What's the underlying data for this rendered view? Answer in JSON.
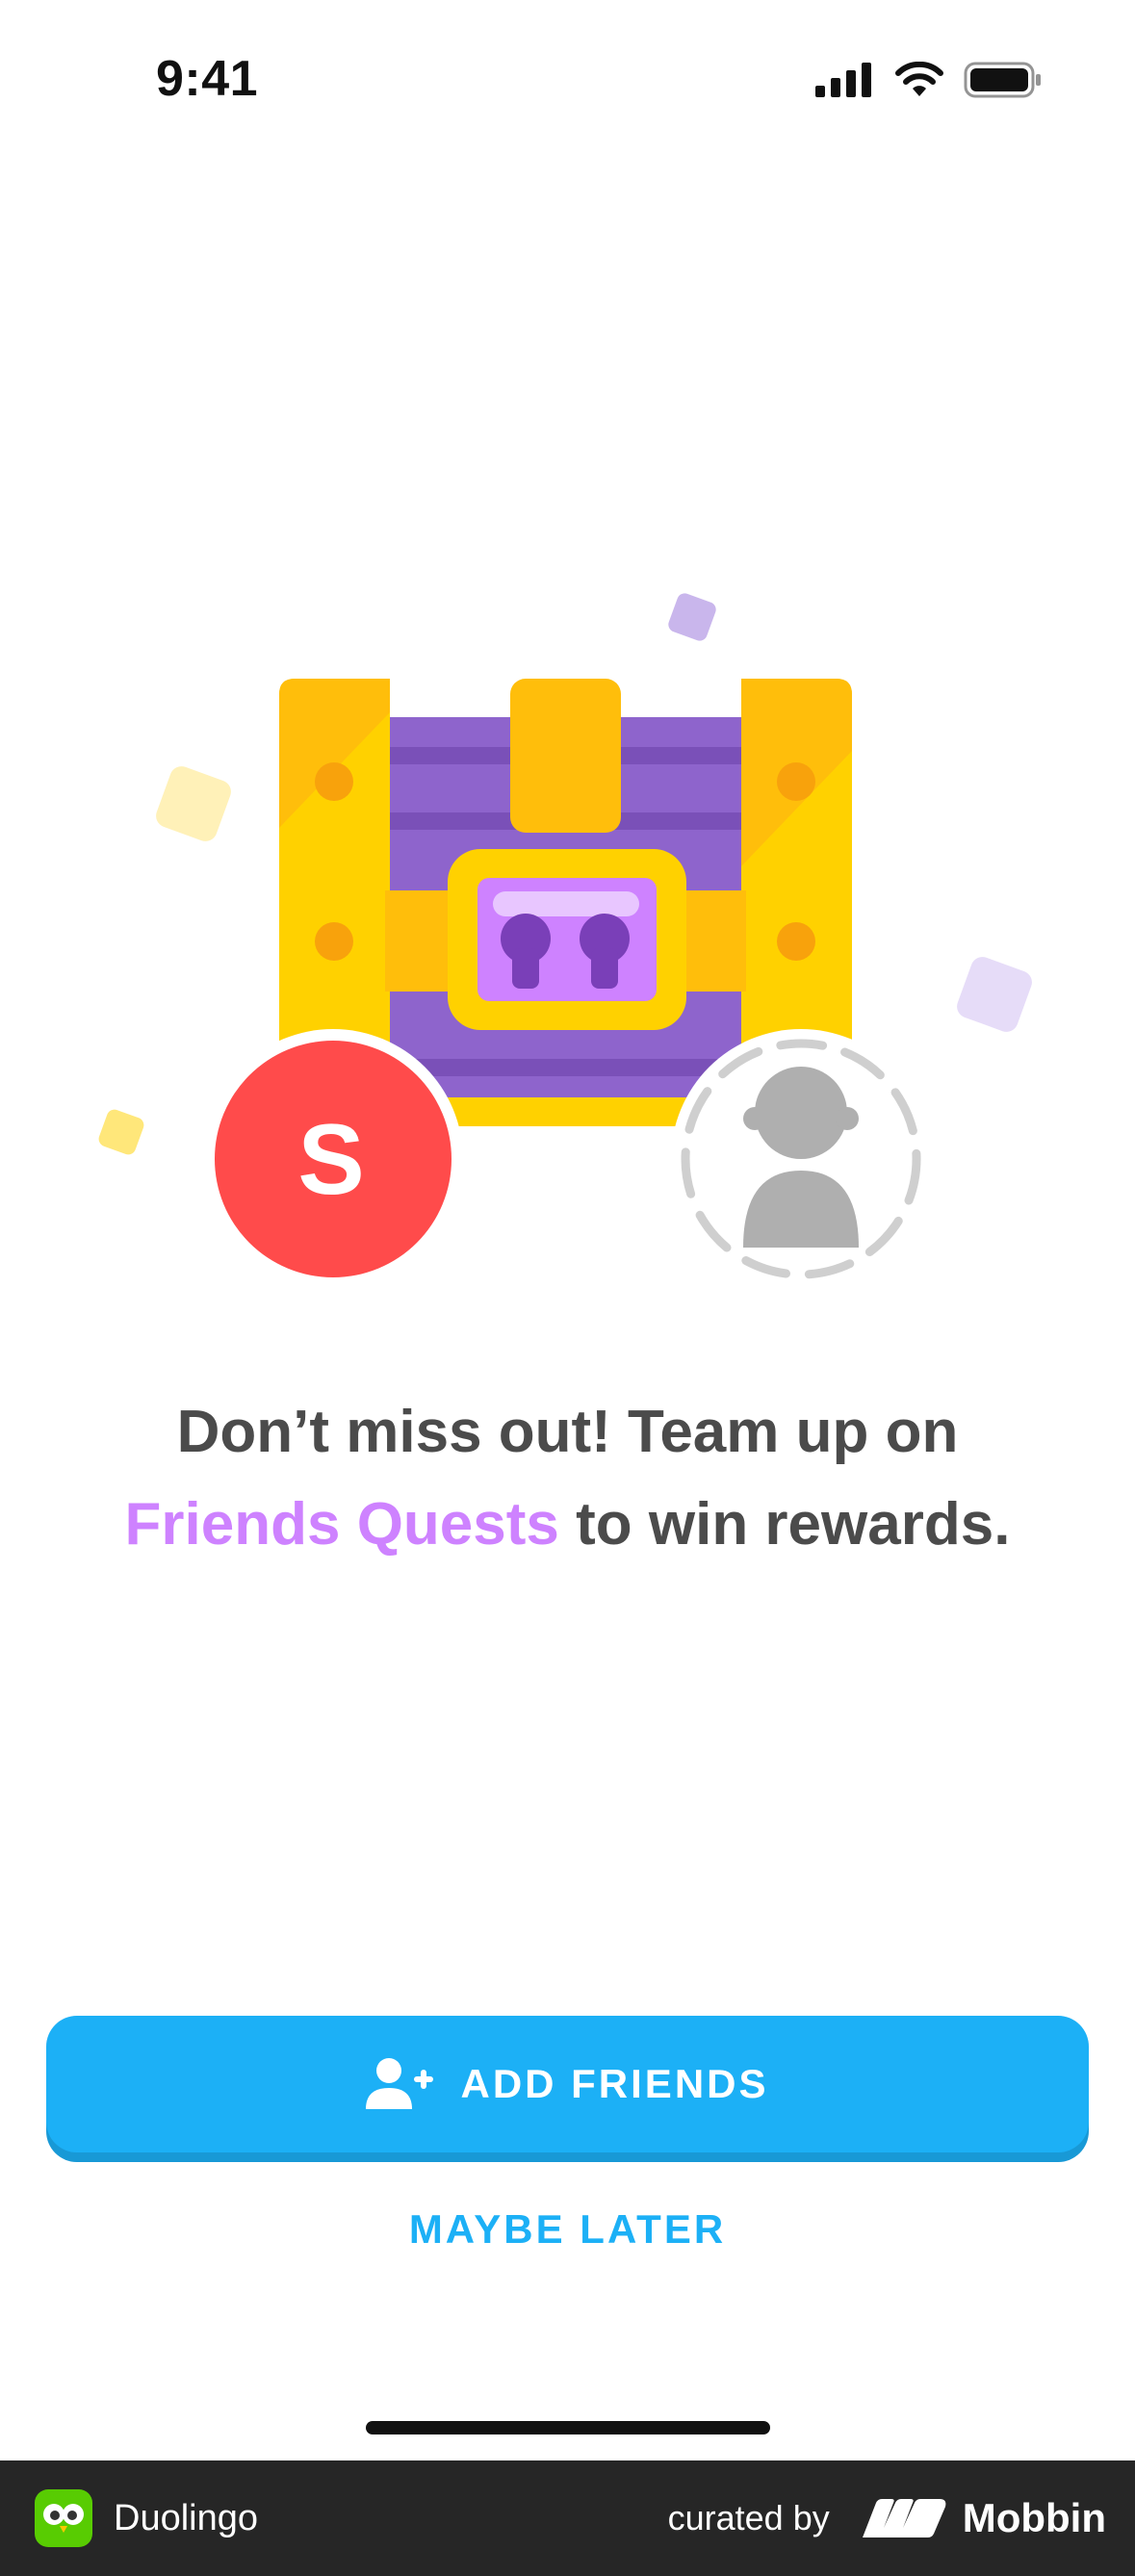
{
  "status_bar": {
    "time": "9:41"
  },
  "hero": {
    "user_initial": "S",
    "icons": [
      "treasure-chest",
      "user-avatar",
      "friend-placeholder-avatar"
    ]
  },
  "headline": {
    "line1": "Don’t miss out! Team up on",
    "accent": "Friends Quests",
    "line2_rest": " to win rewards."
  },
  "actions": {
    "add_friends": "ADD FRIENDS",
    "maybe_later": "MAYBE LATER"
  },
  "footer": {
    "app_name": "Duolingo",
    "curated_by": "curated by",
    "brand": "Mobbin"
  },
  "colors": {
    "primary_blue": "#1cb0f6",
    "accent_purple": "#ce82ff",
    "text_gray": "#4b4b4b",
    "avatar_red": "#ff4b4b",
    "chest_gold": "#ffc800",
    "chest_purple": "#9069cd"
  }
}
